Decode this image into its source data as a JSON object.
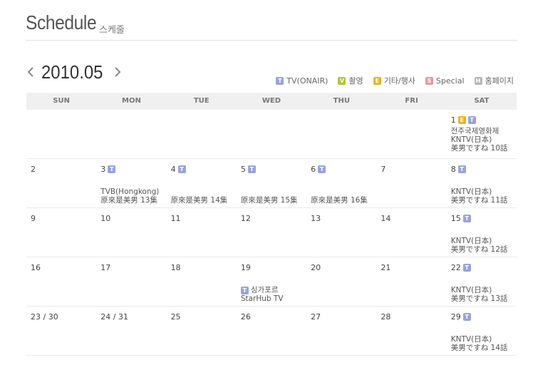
{
  "header": {
    "title": "Schedule",
    "subtitle": "스케줄"
  },
  "nav": {
    "month": "2010.05",
    "prev_icon": "chevron-left-icon",
    "next_icon": "chevron-right-icon"
  },
  "legend": [
    {
      "badge": "T",
      "label": "TV(ONAIR)",
      "color": "#9aa3d9"
    },
    {
      "badge": "V",
      "label": "촬영",
      "color": "#b5c23a"
    },
    {
      "badge": "E",
      "label": "기타/행사",
      "color": "#e6b422"
    },
    {
      "badge": "S",
      "label": "Special",
      "color": "#e79a9a"
    },
    {
      "badge": "H",
      "label": "홈페이지",
      "color": "#b7b7b7"
    }
  ],
  "weekdays": [
    "SUN",
    "MON",
    "TUE",
    "WED",
    "THU",
    "FRI",
    "SAT"
  ],
  "weeks": [
    [
      {
        "day": ""
      },
      {
        "day": ""
      },
      {
        "day": ""
      },
      {
        "day": ""
      },
      {
        "day": ""
      },
      {
        "day": ""
      },
      {
        "day": "1",
        "badges": [
          "E",
          "T"
        ],
        "lines": [
          "전주국제영화제",
          "KNTV(日本)",
          "美男ですね 10話"
        ],
        "top": true
      }
    ],
    [
      {
        "day": "2"
      },
      {
        "day": "3",
        "badges": [
          "T"
        ],
        "lines": [
          "TVB(Hongkong)",
          "原來是美男 13集"
        ]
      },
      {
        "day": "4",
        "badges": [
          "T"
        ],
        "lines": [
          "原來是美男 14集"
        ]
      },
      {
        "day": "5",
        "badges": [
          "T"
        ],
        "lines": [
          "原來是美男 15集"
        ]
      },
      {
        "day": "6",
        "badges": [
          "T"
        ],
        "lines": [
          "原來是美男 16集"
        ]
      },
      {
        "day": "7"
      },
      {
        "day": "8",
        "badges": [
          "T"
        ],
        "lines": [
          "KNTV(日本)",
          "美男ですね 11話"
        ]
      }
    ],
    [
      {
        "day": "9"
      },
      {
        "day": "10"
      },
      {
        "day": "11"
      },
      {
        "day": "12"
      },
      {
        "day": "13"
      },
      {
        "day": "14"
      },
      {
        "day": "15",
        "badges": [
          "T"
        ],
        "lines": [
          "KNTV(日本)",
          "美男ですね 12話"
        ]
      }
    ],
    [
      {
        "day": "16"
      },
      {
        "day": "17"
      },
      {
        "day": "18"
      },
      {
        "day": "19",
        "inline_badge": "T",
        "lines": [
          "싱가포르",
          "StarHub TV"
        ]
      },
      {
        "day": "20"
      },
      {
        "day": "21"
      },
      {
        "day": "22",
        "badges": [
          "T"
        ],
        "lines": [
          "KNTV(日本)",
          "美男ですね 13話"
        ]
      }
    ],
    [
      {
        "day": "23 / 30"
      },
      {
        "day": "24 / 31"
      },
      {
        "day": "25"
      },
      {
        "day": "26"
      },
      {
        "day": "27"
      },
      {
        "day": "28"
      },
      {
        "day": "29",
        "badges": [
          "T"
        ],
        "lines": [
          "KNTV(日本)",
          "美男ですね 14話"
        ]
      }
    ]
  ]
}
